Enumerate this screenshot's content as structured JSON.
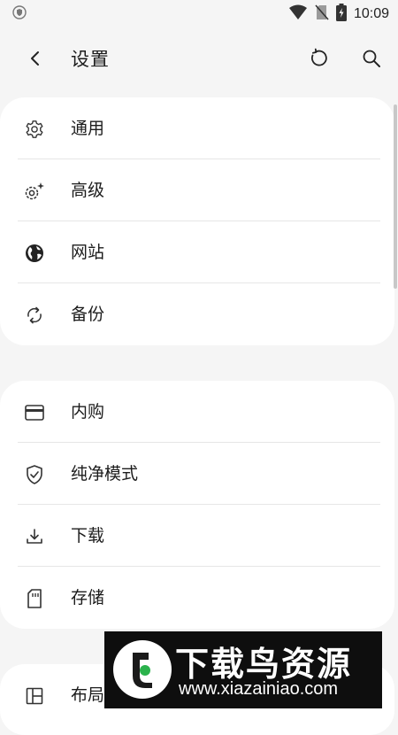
{
  "status_bar": {
    "time": "10:09",
    "icons": [
      "shield-icon",
      "wifi-icon",
      "no-sim-icon",
      "battery-charging-icon"
    ]
  },
  "app_bar": {
    "title": "设置",
    "icons": [
      "back-arrow-icon",
      "reset-icon",
      "search-icon"
    ]
  },
  "sections": [
    {
      "items": [
        {
          "label": "通用",
          "icon": "gear-icon"
        },
        {
          "label": "高级",
          "icon": "gear-sparkle-icon"
        },
        {
          "label": "网站",
          "icon": "globe-icon"
        },
        {
          "label": "备份",
          "icon": "sync-icon"
        }
      ]
    },
    {
      "items": [
        {
          "label": "内购",
          "icon": "credit-card-icon"
        },
        {
          "label": "纯净模式",
          "icon": "shield-check-icon"
        },
        {
          "label": "下载",
          "icon": "download-icon"
        },
        {
          "label": "存储",
          "icon": "sd-card-icon"
        }
      ]
    },
    {
      "items": [
        {
          "label": "布局",
          "icon": "layout-icon"
        }
      ]
    }
  ],
  "watermark": {
    "title": "下载鸟资源",
    "url": "www.xiazainiao.com"
  }
}
